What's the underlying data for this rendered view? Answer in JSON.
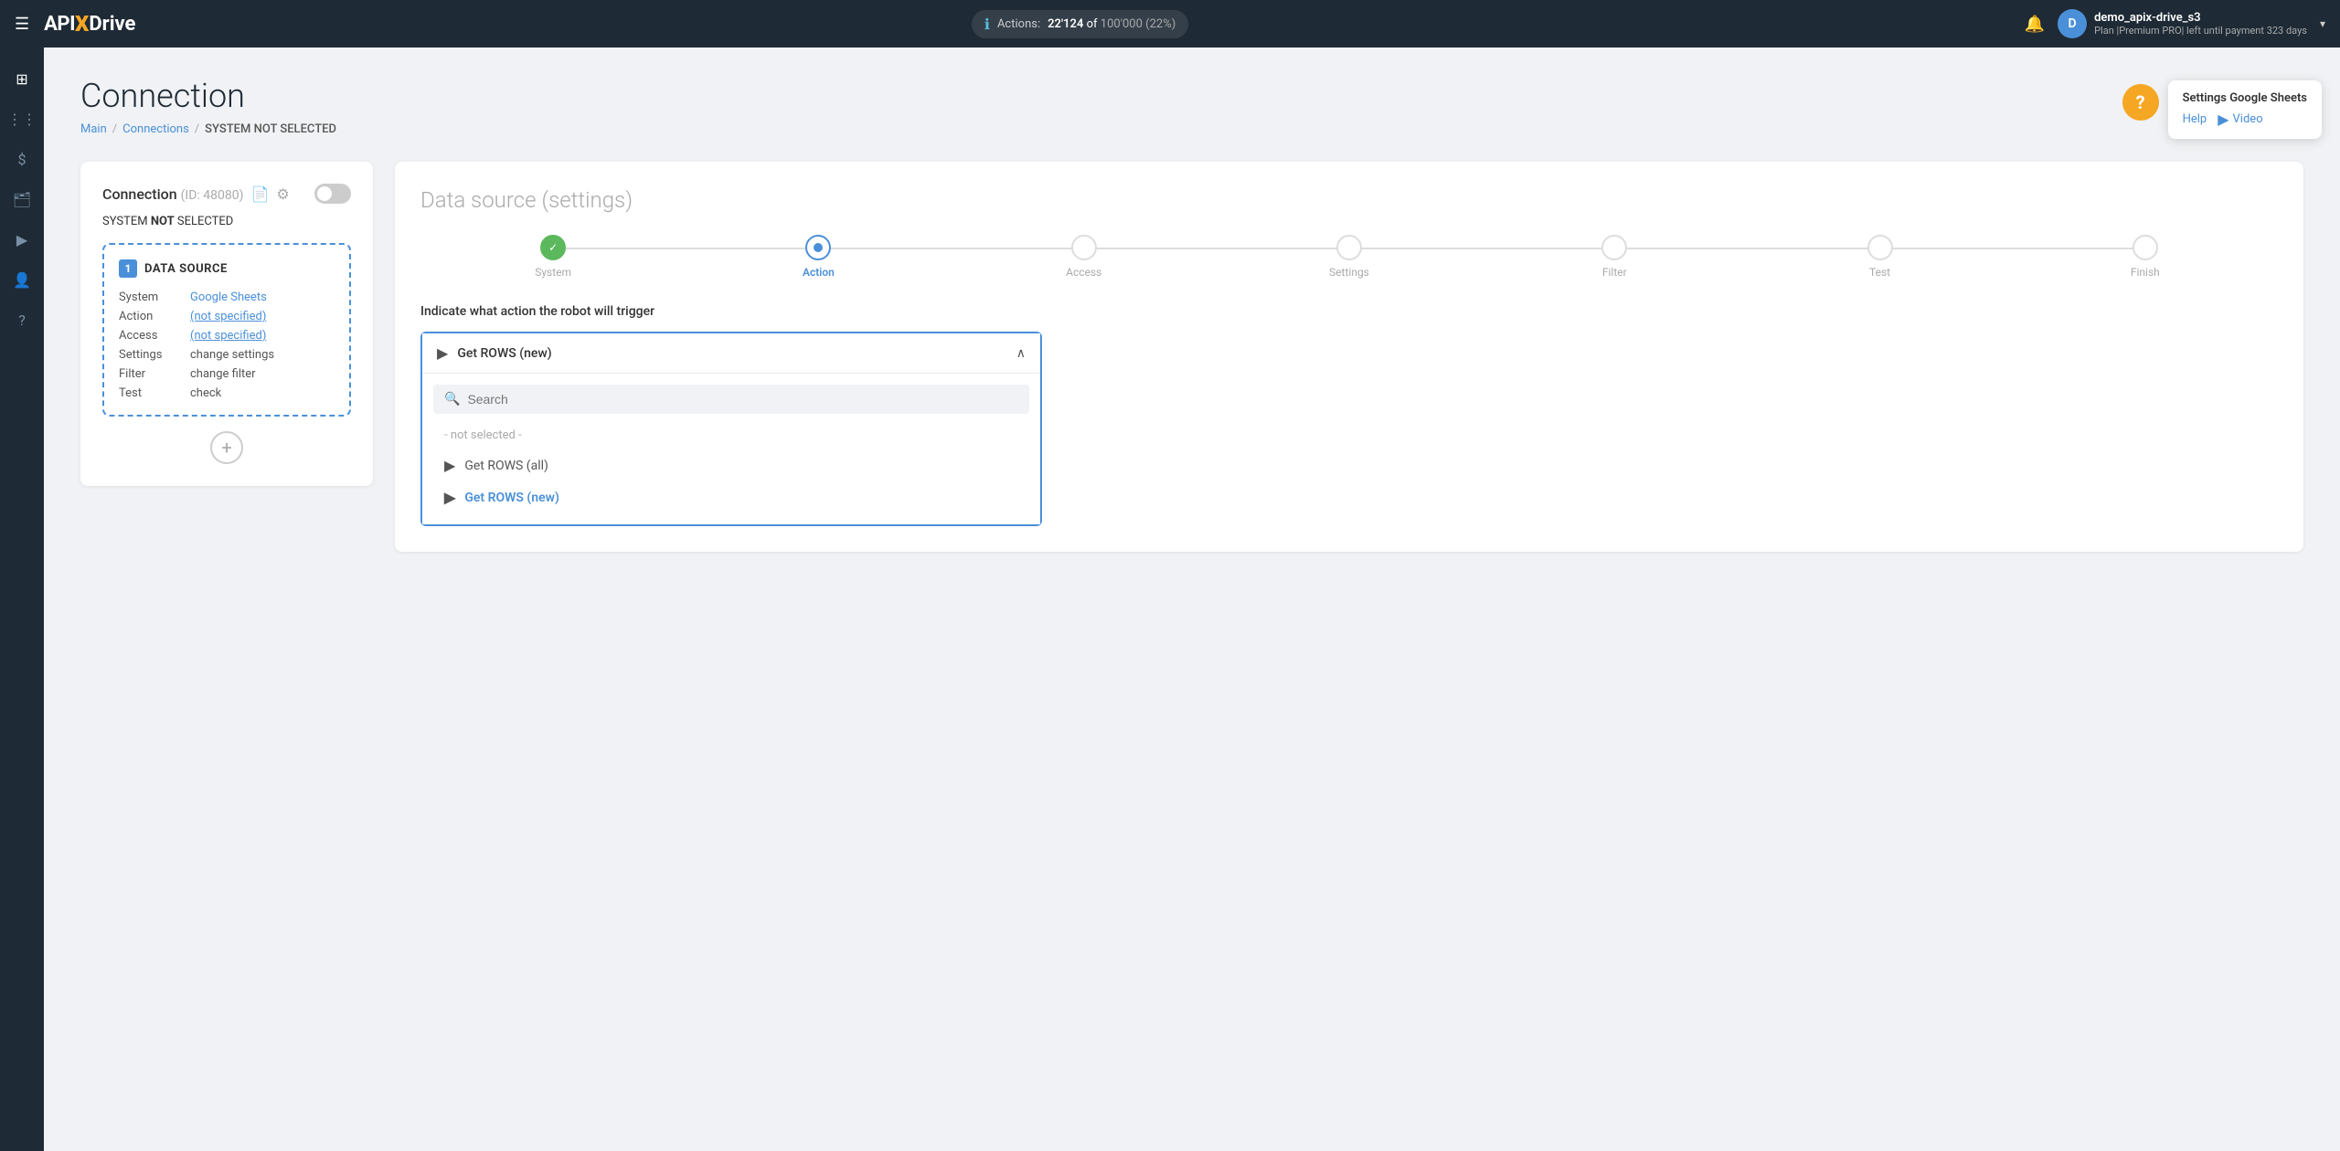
{
  "navbar": {
    "menu_icon": "☰",
    "logo": {
      "api": "API",
      "x": "X",
      "drive": "Drive"
    },
    "actions": {
      "label": "Actions:",
      "used": "22'124",
      "of_text": "of",
      "total": "100'000",
      "percent": "(22%)"
    },
    "bell_icon": "🔔",
    "user": {
      "name": "demo_apix-drive_s3",
      "plan": "Plan |Premium PRO| left until payment 323 days",
      "avatar_letter": "D"
    },
    "chevron": "▾"
  },
  "sidebar": {
    "items": [
      {
        "icon": "⊞",
        "name": "dashboard"
      },
      {
        "icon": "⋮⋮",
        "name": "connections"
      },
      {
        "icon": "$",
        "name": "billing"
      },
      {
        "icon": "🗂",
        "name": "tasks"
      },
      {
        "icon": "▶",
        "name": "media"
      },
      {
        "icon": "👤",
        "name": "account"
      },
      {
        "icon": "?",
        "name": "help"
      }
    ]
  },
  "page": {
    "title": "Connection",
    "breadcrumb": {
      "main": "Main",
      "connections": "Connections",
      "separator": "/",
      "current": "SYSTEM NOT SELECTED"
    }
  },
  "left_panel": {
    "header": {
      "title": "Connection",
      "id_prefix": "(ID:",
      "id": "48080",
      "id_suffix": ")",
      "doc_icon": "📄",
      "settings_icon": "⚙"
    },
    "system_status": {
      "prefix": "SYSTEM ",
      "highlight": "NOT",
      "suffix": " SELECTED"
    },
    "data_source": {
      "number": "1",
      "title": "DATA SOURCE",
      "rows": [
        {
          "label": "System",
          "value": "Google Sheets",
          "type": "link"
        },
        {
          "label": "Action",
          "value": "(not specified)",
          "type": "link-underline"
        },
        {
          "label": "Access",
          "value": "(not specified)",
          "type": "link-underline"
        },
        {
          "label": "Settings",
          "value": "change settings",
          "type": "plain"
        },
        {
          "label": "Filter",
          "value": "change filter",
          "type": "plain"
        },
        {
          "label": "Test",
          "value": "check",
          "type": "plain"
        }
      ]
    },
    "add_button": "+"
  },
  "right_panel": {
    "title": "Data source",
    "title_sub": "(settings)",
    "steps": [
      {
        "label": "System",
        "state": "done"
      },
      {
        "label": "Action",
        "state": "active"
      },
      {
        "label": "Access",
        "state": "inactive"
      },
      {
        "label": "Settings",
        "state": "inactive"
      },
      {
        "label": "Filter",
        "state": "inactive"
      },
      {
        "label": "Test",
        "state": "inactive"
      },
      {
        "label": "Finish",
        "state": "inactive"
      }
    ],
    "instruction": "Indicate what action the robot will trigger",
    "dropdown": {
      "selected": "Get ROWS (new)",
      "play_icon": "▶",
      "chevron": "∧",
      "search_placeholder": "Search",
      "not_selected": "- not selected -",
      "options": [
        {
          "label": "Get ROWS (all)",
          "selected": false
        },
        {
          "label": "Get ROWS (new)",
          "selected": true
        }
      ]
    }
  },
  "help_widget": {
    "icon": "?",
    "title": "Settings Google Sheets",
    "help_label": "Help",
    "video_label": "Video",
    "video_icon": "▶"
  }
}
